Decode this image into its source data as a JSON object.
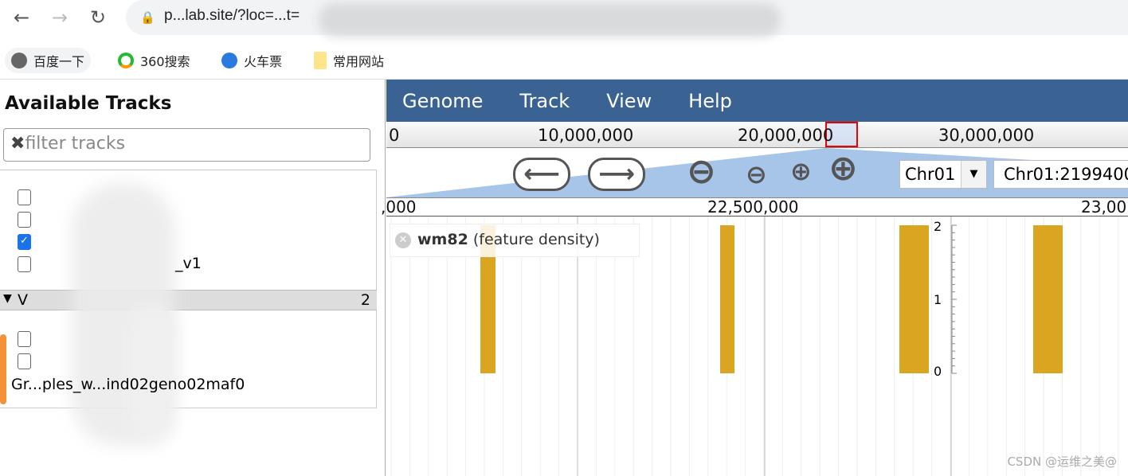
{
  "browser": {
    "url": "p...lab.site/?loc=...t=",
    "bookmarks": [
      {
        "label": "百度一下",
        "icon": "globe-icon"
      },
      {
        "label": "360搜索",
        "icon": "360-icon"
      },
      {
        "label": "火车票",
        "icon": "train-icon"
      },
      {
        "label": "常用网站",
        "icon": "folder-icon"
      }
    ]
  },
  "sidebar": {
    "title": "Available Tracks",
    "filter_placeholder": "filter tracks",
    "tracks": [
      {
        "label": "",
        "checked": false
      },
      {
        "label": "",
        "checked": false
      },
      {
        "label": "",
        "checked": true
      },
      {
        "label": "_v1",
        "checked": false
      }
    ],
    "category": {
      "label": "V",
      "count": "2"
    },
    "tracks2": [
      {
        "label": "",
        "checked": false
      },
      {
        "label": "",
        "checked": false
      }
    ],
    "long_label": "Gr...ples_w...ind02geno02maf0"
  },
  "menu": [
    "Genome",
    "Track",
    "View",
    "Help"
  ],
  "overview": {
    "ticks": [
      "0",
      "10,000,000",
      "20,000,000",
      "30,000,000"
    ]
  },
  "navigation": {
    "chromosome": "Chr01",
    "location": "Chr01:2199400"
  },
  "ruler": {
    "ticks": [
      ",000",
      "22,500,000",
      "23,00"
    ]
  },
  "track": {
    "name": "wm82",
    "type": "(feature density)",
    "bar_color": "#daa520",
    "y_axis": [
      "2",
      "1",
      "0"
    ],
    "bar_values": [
      2,
      2,
      2,
      2
    ]
  },
  "watermark": "CSDN @运维之美@"
}
